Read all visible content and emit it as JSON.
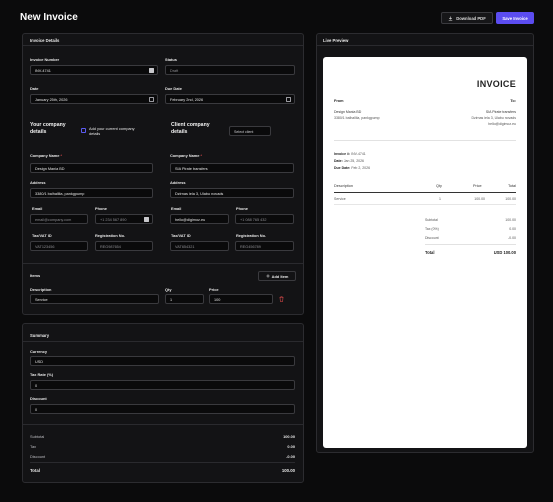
{
  "page": {
    "title": "New Invoice"
  },
  "actions": {
    "download_pdf": "Download PDF",
    "save_invoice": "Save Invoice"
  },
  "invoice_details": {
    "heading": "Invoice Details",
    "invoice_number_label": "Invoice Number",
    "invoice_number_value": "INV-4741",
    "status_label": "Status",
    "status_value": "Draft",
    "date_label": "Date",
    "date_value": "January 25th, 2026",
    "due_date_label": "Due Date",
    "due_date_value": "February 2nd, 2026"
  },
  "company": {
    "heading_line1": "Your company",
    "heading_line2": "details",
    "add_current_line1": "Add your current company",
    "add_current_line2": "details",
    "name_label": "Company Name",
    "name_required": "*",
    "name_value": "Design Mania BD",
    "address_label": "Address",
    "address_value": "3380/1 balhallila, pankgpump",
    "email_label": "Email",
    "email_placeholder": "email@company.com",
    "phone_label": "Phone",
    "phone_value": "+1 234 567 890",
    "tax_label": "Tax/VAT ID",
    "tax_value": "VAT123456",
    "reg_label": "Registration No.",
    "reg_value": "REG987654"
  },
  "client": {
    "heading_line1": "Client company",
    "heading_line2": "details",
    "select_label": "Select client",
    "name_label": "Company Name",
    "name_required": "*",
    "name_value": "SIA Pirate transfers",
    "address_label": "Address",
    "address_value": "Dzirnas iela 3, Ulabu novads",
    "email_label": "Email",
    "email_value": "hello@digimoz.eu",
    "phone_label": "Phone",
    "phone_value": "+1 088 765 432",
    "tax_label": "Tax/VAT ID",
    "tax_value": "VAT654321",
    "reg_label": "Registration No.",
    "reg_value": "REG456789"
  },
  "items": {
    "heading": "Items",
    "add_label": "Add Item",
    "col_description": "Description",
    "col_qty": "Qty",
    "col_price": "Price",
    "rows": [
      {
        "description": "Service",
        "qty": "1",
        "price": "100"
      }
    ]
  },
  "summary": {
    "heading": "Summary",
    "currency_label": "Currency",
    "currency_value": "USD",
    "tax_rate_label": "Tax Rate (%)",
    "tax_rate_value": "0",
    "discount_label": "Discount",
    "discount_value": "0",
    "subtotal_label": "Subtotal",
    "subtotal_value": "100.00",
    "tax_label": "Tax",
    "tax_value": "0.00",
    "discount_row_label": "Discount",
    "discount_row_value": "-0.00",
    "total_label": "Total",
    "total_value": "100.00"
  },
  "preview": {
    "heading": "Live Preview",
    "doc_title": "INVOICE",
    "from_label": "From",
    "to_label": "To:",
    "from_name": "Design Mania BD",
    "from_address": "3380/1 balhallila, pankgpump",
    "to_name": "SIA Pirate transfers",
    "to_address": "Dzirnas iela 3, Ulabu novads",
    "to_email": "hello@digimoz.eu",
    "invoice_no_label": "Invoice #:",
    "invoice_no_value": "INV-4741",
    "date_label": "Date:",
    "date_value": "Jan 25, 2026",
    "due_label": "Due Date:",
    "due_value": "Feb 2, 2026",
    "col_description": "Description",
    "col_qty": "Qty",
    "col_price": "Price",
    "col_total": "Total",
    "row_description": "Service",
    "row_qty": "1",
    "row_price": "100.00",
    "row_total": "100.00",
    "subtotal_label": "Subtotal",
    "subtotal_value": "100.00",
    "tax_label": "Tax (0%)",
    "tax_value": "0.00",
    "discount_label": "Discount",
    "discount_value": "-0.00",
    "total_label": "Total",
    "total_value": "USD 100.00"
  },
  "colors": {
    "accent": "#5b4cf0",
    "background": "#0b0b0c",
    "card": "#131315",
    "danger": "#e14b4b"
  },
  "icons": {
    "download": "download-icon",
    "plus": "plus-icon",
    "calendar": "calendar-icon",
    "trash": "trash-icon"
  }
}
